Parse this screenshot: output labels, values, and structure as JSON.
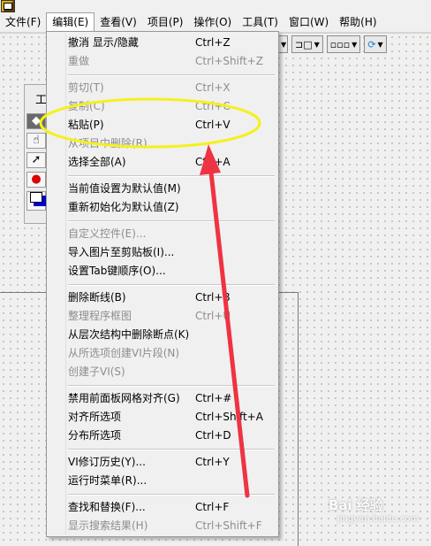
{
  "menubar": {
    "items": [
      {
        "label": "文件(F)",
        "active": false
      },
      {
        "label": "编辑(E)",
        "active": true
      },
      {
        "label": "查看(V)",
        "active": false
      },
      {
        "label": "项目(P)",
        "active": false
      },
      {
        "label": "操作(O)",
        "active": false
      },
      {
        "label": "工具(T)",
        "active": false
      },
      {
        "label": "窗口(W)",
        "active": false
      },
      {
        "label": "帮助(H)",
        "active": false
      }
    ]
  },
  "palette": {
    "title": "工"
  },
  "edit_menu": {
    "groups": [
      [
        {
          "label": "撤消 显示/隐藏",
          "shortcut": "Ctrl+Z",
          "enabled": true
        },
        {
          "label": "重做",
          "shortcut": "Ctrl+Shift+Z",
          "enabled": false
        }
      ],
      [
        {
          "label": "剪切(T)",
          "shortcut": "Ctrl+X",
          "enabled": false
        },
        {
          "label": "复制(C)",
          "shortcut": "Ctrl+C",
          "enabled": false
        },
        {
          "label": "粘贴(P)",
          "shortcut": "Ctrl+V",
          "enabled": true
        },
        {
          "label": "从项目中删除(R)",
          "shortcut": "",
          "enabled": false
        },
        {
          "label": "选择全部(A)",
          "shortcut": "Ctrl+A",
          "enabled": true
        }
      ],
      [
        {
          "label": "当前值设置为默认值(M)",
          "shortcut": "",
          "enabled": true
        },
        {
          "label": "重新初始化为默认值(Z)",
          "shortcut": "",
          "enabled": true
        }
      ],
      [
        {
          "label": "自定义控件(E)...",
          "shortcut": "",
          "enabled": false
        },
        {
          "label": "导入图片至剪贴板(I)...",
          "shortcut": "",
          "enabled": true
        },
        {
          "label": "设置Tab键顺序(O)...",
          "shortcut": "",
          "enabled": true
        }
      ],
      [
        {
          "label": "删除断线(B)",
          "shortcut": "Ctrl+B",
          "enabled": true
        },
        {
          "label": "整理程序框图",
          "shortcut": "Ctrl+U",
          "enabled": false
        },
        {
          "label": "从层次结构中删除断点(K)",
          "shortcut": "",
          "enabled": true
        },
        {
          "label": "从所选项创建VI片段(N)",
          "shortcut": "",
          "enabled": false
        },
        {
          "label": "创建子VI(S)",
          "shortcut": "",
          "enabled": false
        }
      ],
      [
        {
          "label": "禁用前面板网格对齐(G)",
          "shortcut": "Ctrl+#",
          "enabled": true
        },
        {
          "label": "对齐所选项",
          "shortcut": "Ctrl+Shift+A",
          "enabled": true
        },
        {
          "label": "分布所选项",
          "shortcut": "Ctrl+D",
          "enabled": true
        }
      ],
      [
        {
          "label": "VI修订历史(Y)...",
          "shortcut": "Ctrl+Y",
          "enabled": true
        },
        {
          "label": "运行时菜单(R)...",
          "shortcut": "",
          "enabled": true
        }
      ],
      [
        {
          "label": "查找和替换(F)...",
          "shortcut": "Ctrl+F",
          "enabled": true
        },
        {
          "label": "显示搜索结果(H)",
          "shortcut": "Ctrl+Shift+F",
          "enabled": false
        }
      ]
    ]
  },
  "colors": {
    "highlight_ellipse": "#f5f01e",
    "arrow": "#ee3344"
  },
  "watermark": {
    "line1": "Bai 经验",
    "line2": "jingyan.baidu.com"
  }
}
